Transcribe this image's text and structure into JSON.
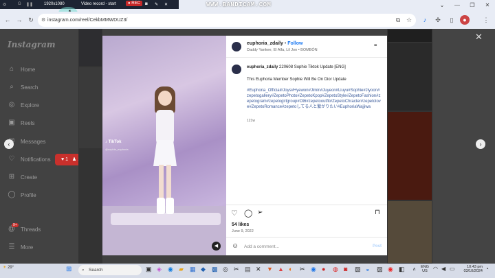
{
  "recorder": {
    "resolution": "1920x1080",
    "status": "Video record - start",
    "rec_label": "REC",
    "watermark": "WWW.BANDICAM.COM"
  },
  "browser": {
    "url": "instagram.com/reel/CekbMMWDUZ3/"
  },
  "instagram": {
    "logo": "Instagram",
    "nav": [
      {
        "label": "Home",
        "icon": "home-icon",
        "glyph": "⌂"
      },
      {
        "label": "Search",
        "icon": "search-icon",
        "glyph": "⌕"
      },
      {
        "label": "Explore",
        "icon": "compass-icon",
        "glyph": "◎"
      },
      {
        "label": "Reels",
        "icon": "reels-icon",
        "glyph": "▣"
      },
      {
        "label": "Messages",
        "icon": "messenger-icon",
        "glyph": "✉"
      },
      {
        "label": "Notifications",
        "icon": "heart-icon",
        "glyph": "♡"
      },
      {
        "label": "Create",
        "icon": "plus-square-icon",
        "glyph": "⊞"
      },
      {
        "label": "Profile",
        "icon": "profile-icon",
        "glyph": "◯"
      },
      {
        "label": "Threads",
        "icon": "threads-icon",
        "glyph": "@"
      },
      {
        "label": "More",
        "icon": "menu-icon",
        "glyph": "☰"
      }
    ],
    "notification_badge": {
      "likes": "1",
      "follows": "1"
    },
    "threads_badge": "9+"
  },
  "post": {
    "username": "euphoria_zdaily",
    "follow_label": "Follow",
    "dot": "•",
    "audio": "Daddy Yankee, El Alfa, Lil Jon • BOMBÓN",
    "caption_user": "euphoria_zdaily",
    "caption_title": "220608 Sophie Tiktok Update [ENG]",
    "caption_body": "This Euphoria Member Sophie Will Be On Dior Update",
    "hashtags": "#Euphoria_Official#Joys#Hyewon#Jimin#Juyeon#Liuyu#Sophie#Jiyoon#zepetogallery#ZepetoPhoto#ZepetoKpop#ZepetoStyle#ZepetoFashion#zepetogram#zepetogirlgroup#Ot6#zepetooutfit#ZepetoChracter#zepetolove#ZepetoRomance#zepetoしてる人と繋がりたい#EuphoriaWajjiwa",
    "caption_age": "121w",
    "likes": "54 likes",
    "date": "June 9, 2022",
    "comment_placeholder": "Add a comment...",
    "post_label": "Post",
    "more_glyph": "•••",
    "tiktok_label": "TikTok",
    "tiktok_handle": "@sophie_euphoria"
  },
  "taskbar": {
    "weather": "29°",
    "search_placeholder": "Search",
    "lang_top": "ENG",
    "lang_bottom": "US",
    "time": "10:43 pm",
    "date": "03/10/2024"
  }
}
